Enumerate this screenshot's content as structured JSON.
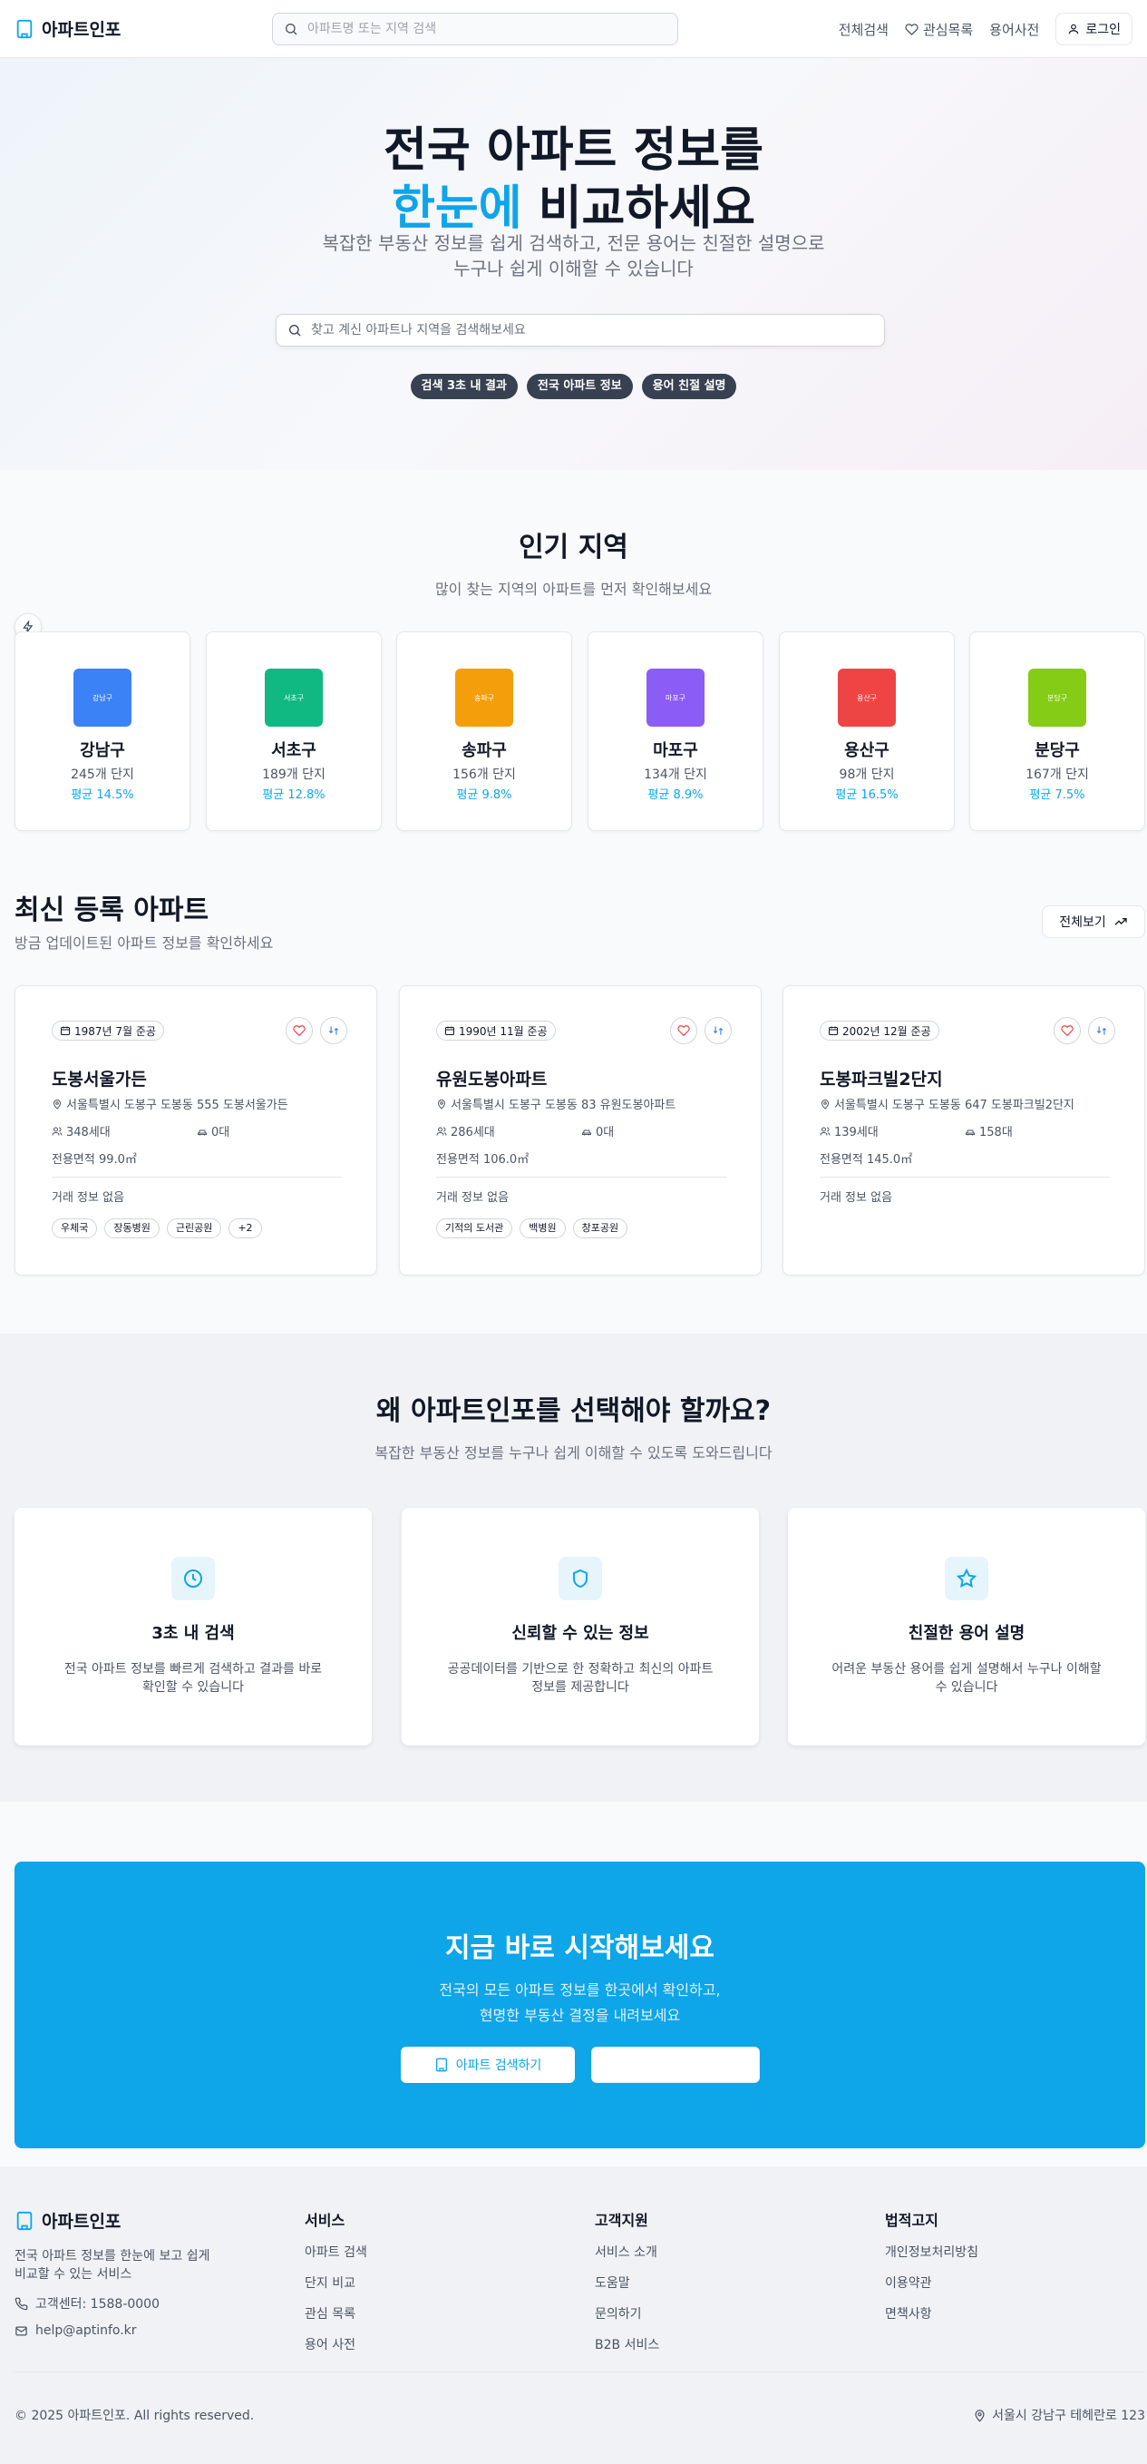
{
  "header": {
    "logo": "아파트인포",
    "search_placeholder": "아파트명 또는 지역 검색",
    "nav": [
      "전체검색",
      "관심목록",
      "용어사전"
    ],
    "login": "로그인"
  },
  "hero": {
    "title_line1": "전국 아파트 정보를",
    "title_accent": "한눈에",
    "title_rest": " 비교하세요",
    "sub_line1": "복잡한 부동산 정보를 쉽게 검색하고, 전문 용어는 친절한 설명으로",
    "sub_line2": "누구나 쉽게 이해할 수 있습니다",
    "search_placeholder": "찾고 계신 아파트나 지역을 검색해보세요",
    "badges": [
      "검색 3초 내 결과",
      "전국 아파트 정보",
      "용어 친절 설명"
    ]
  },
  "regions": {
    "title": "인기 지역",
    "subtitle": "많이 찾는 지역의 아파트를 먼저 확인해보세요",
    "items": [
      {
        "name": "강남구",
        "thumb": "강남구",
        "count": "245개 단지",
        "rate": "평균 14.5%",
        "color": "#3b82f6"
      },
      {
        "name": "서초구",
        "thumb": "서초구",
        "count": "189개 단지",
        "rate": "평균 12.8%",
        "color": "#10b981"
      },
      {
        "name": "송파구",
        "thumb": "송파구",
        "count": "156개 단지",
        "rate": "평균 9.8%",
        "color": "#f59e0b"
      },
      {
        "name": "마포구",
        "thumb": "마포구",
        "count": "134개 단지",
        "rate": "평균 8.9%",
        "color": "#8b5cf6"
      },
      {
        "name": "용산구",
        "thumb": "용산구",
        "count": "98개 단지",
        "rate": "평균 16.5%",
        "color": "#ef4444"
      },
      {
        "name": "분당구",
        "thumb": "분당구",
        "count": "167개 단지",
        "rate": "평균 7.5%",
        "color": "#84cc16"
      }
    ]
  },
  "latest": {
    "title": "최신 등록 아파트",
    "subtitle": "방금 업데이트된 아파트 정보를 확인하세요",
    "see_all": "전체보기",
    "items": [
      {
        "date": "1987년 7월 준공",
        "name": "도봉서울가든",
        "address": "서울특별시 도봉구 도봉동 555 도봉서울가든",
        "households": "348세대",
        "parking": "0대",
        "area": "전용면적 99.0㎡",
        "deal": "거래 정보 없음",
        "tags": [
          "우체국",
          "장동병원",
          "근린공원",
          "+2"
        ]
      },
      {
        "date": "1990년 11월 준공",
        "name": "유원도봉아파트",
        "address": "서울특별시 도봉구 도봉동 83 유원도봉아파트",
        "households": "286세대",
        "parking": "0대",
        "area": "전용면적 106.0㎡",
        "deal": "거래 정보 없음",
        "tags": [
          "기적의 도서관",
          "백병원",
          "창포공원"
        ]
      },
      {
        "date": "2002년 12월 준공",
        "name": "도봉파크빌2단지",
        "address": "서울특별시 도봉구 도봉동 647 도봉파크빌2단지",
        "households": "139세대",
        "parking": "158대",
        "area": "전용면적 145.0㎡",
        "deal": "거래 정보 없음",
        "tags": []
      }
    ]
  },
  "why": {
    "title": "왜 아파트인포를 선택해야 할까요?",
    "subtitle": "복잡한 부동산 정보를 누구나 쉽게 이해할 수 있도록 도와드립니다",
    "features": [
      {
        "icon": "clock-icon",
        "title": "3초 내 검색",
        "desc": "전국 아파트 정보를 빠르게 검색하고 결과를 바로 확인할 수 있습니다"
      },
      {
        "icon": "shield-icon",
        "title": "신뢰할 수 있는 정보",
        "desc": "공공데이터를 기반으로 한 정확하고 최신의 아파트 정보를 제공합니다"
      },
      {
        "icon": "star-icon",
        "title": "친절한 용어 설명",
        "desc": "어려운 부동산 용어를 쉽게 설명해서 누구나 이해할 수 있습니다"
      }
    ]
  },
  "cta": {
    "title": "지금 바로 시작해보세요",
    "line1": "전국의 모든 아파트 정보를 한곳에서 확인하고,",
    "line2": "현명한 부동산 결정을 내려보세요",
    "button1": "아파트 검색하기",
    "button2": ""
  },
  "footer": {
    "logo": "아파트인포",
    "desc": "전국 아파트 정보를 한눈에 보고 쉽게 비교할 수 있는 서비스",
    "phone": "고객센터: 1588-0000",
    "email": "help@aptinfo.kr",
    "columns": [
      {
        "head": "서비스",
        "links": [
          "아파트 검색",
          "단지 비교",
          "관심 목록",
          "용어 사전"
        ]
      },
      {
        "head": "고객지원",
        "links": [
          "서비스 소개",
          "도움말",
          "문의하기",
          "B2B 서비스"
        ]
      },
      {
        "head": "법적고지",
        "links": [
          "개인정보처리방침",
          "이용약관",
          "면책사항"
        ]
      }
    ],
    "copyright": "© 2025 아파트인포. All rights reserved.",
    "address": "서울시 강남구 테헤란로 123"
  },
  "colors": {
    "accent": "#0ea5e9",
    "dark": "#111827"
  }
}
